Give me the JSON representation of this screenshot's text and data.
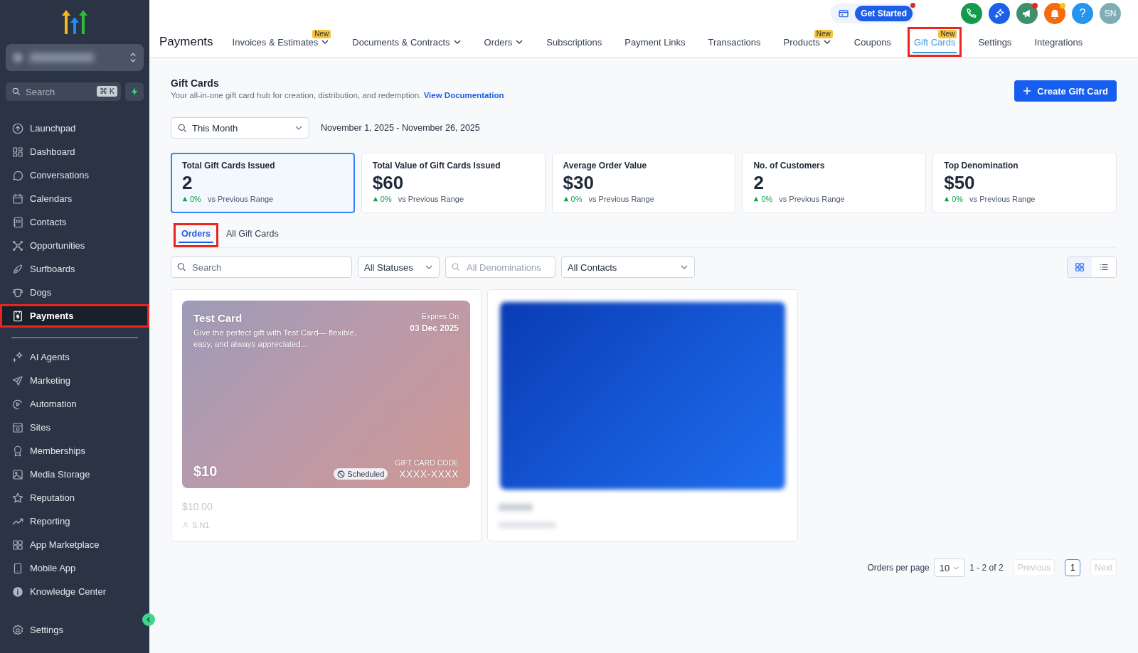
{
  "sidebar": {
    "search": {
      "placeholder": "Search",
      "shortcut": "⌘ K"
    },
    "items": [
      {
        "label": "Launchpad",
        "selected": false,
        "highlighted": false
      },
      {
        "label": "Dashboard",
        "selected": false,
        "highlighted": false
      },
      {
        "label": "Conversations",
        "selected": false,
        "highlighted": false
      },
      {
        "label": "Calendars",
        "selected": false,
        "highlighted": false
      },
      {
        "label": "Contacts",
        "selected": false,
        "highlighted": false
      },
      {
        "label": "Opportunities",
        "selected": false,
        "highlighted": false
      },
      {
        "label": "Surfboards",
        "selected": false,
        "highlighted": false
      },
      {
        "label": "Dogs",
        "selected": false,
        "highlighted": false
      },
      {
        "label": "Payments",
        "selected": true,
        "highlighted": true
      }
    ],
    "items_2": [
      {
        "label": "AI Agents",
        "selected": false
      },
      {
        "label": "Marketing",
        "selected": false
      },
      {
        "label": "Automation",
        "selected": false
      },
      {
        "label": "Sites",
        "selected": false
      },
      {
        "label": "Memberships",
        "selected": false
      },
      {
        "label": "Media Storage",
        "selected": false
      },
      {
        "label": "Reputation",
        "selected": false
      },
      {
        "label": "Reporting",
        "selected": false
      },
      {
        "label": "App Marketplace",
        "selected": false
      },
      {
        "label": "Mobile App",
        "selected": false
      },
      {
        "label": "Knowledge Center",
        "selected": false
      }
    ],
    "footer_item": {
      "label": "Settings"
    }
  },
  "header": {
    "get_started": {
      "label": "Get Started",
      "dot": true
    },
    "actions": [
      {
        "kind": "phone",
        "color": "#15994a"
      },
      {
        "kind": "sparkle",
        "color": "#1c5fe8"
      },
      {
        "kind": "megaphone",
        "color": "#3f8f6c",
        "dot": {
          "color": "#ef2323"
        }
      },
      {
        "kind": "bell",
        "color": "#f66a0f",
        "dot": {
          "color": "#f5c518"
        }
      },
      {
        "kind": "help",
        "color": "#2496f2",
        "label": "?"
      }
    ],
    "avatar": "SN"
  },
  "nav": {
    "title": "Payments",
    "tabs": [
      {
        "label": "Invoices & Estimates",
        "badge": "New",
        "dropdown": true,
        "selected": false,
        "highlighted": false
      },
      {
        "label": "Documents & Contracts",
        "dropdown": true,
        "selected": false,
        "highlighted": false
      },
      {
        "label": "Orders",
        "dropdown": true,
        "selected": false,
        "highlighted": false
      },
      {
        "label": "Subscriptions",
        "dropdown": false,
        "selected": false,
        "highlighted": false
      },
      {
        "label": "Payment Links",
        "dropdown": false,
        "selected": false,
        "highlighted": false
      },
      {
        "label": "Transactions",
        "dropdown": false,
        "selected": false,
        "highlighted": false
      },
      {
        "label": "Products",
        "badge": "New",
        "dropdown": true,
        "selected": false,
        "highlighted": false
      },
      {
        "label": "Coupons",
        "dropdown": false,
        "selected": false,
        "highlighted": false
      },
      {
        "label": "Gift Cards",
        "badge": "New",
        "dropdown": false,
        "selected": true,
        "highlighted": true
      },
      {
        "label": "Settings",
        "dropdown": false,
        "selected": false,
        "highlighted": false
      },
      {
        "label": "Integrations",
        "dropdown": false,
        "selected": false,
        "highlighted": false
      }
    ]
  },
  "page": {
    "title": "Gift Cards",
    "description": "Your all-in-one gift card hub for creation, distribution, and redemption.",
    "link": "View Documentation",
    "create_button": "Create Gift Card"
  },
  "date_filter": {
    "value": "This Month",
    "range": "November 1, 2025 - November 26, 2025"
  },
  "stats": [
    {
      "title": "Total Gift Cards Issued",
      "value": "2",
      "change": "0%",
      "compare": "vs Previous Range",
      "selected": true
    },
    {
      "title": "Total Value of Gift Cards Issued",
      "value": "$60",
      "change": "0%",
      "compare": "vs Previous Range",
      "selected": false
    },
    {
      "title": "Average Order Value",
      "value": "$30",
      "change": "0%",
      "compare": "vs Previous Range",
      "selected": false
    },
    {
      "title": "No. of Customers",
      "value": "2",
      "change": "0%",
      "compare": "vs Previous Range",
      "selected": false
    },
    {
      "title": "Top Denomination",
      "value": "$50",
      "change": "0%",
      "compare": "vs Previous Range",
      "selected": false
    }
  ],
  "subtabs": [
    {
      "label": "Orders",
      "selected": true,
      "highlighted": true
    },
    {
      "label": "All Gift Cards",
      "selected": false,
      "highlighted": false
    }
  ],
  "filters": {
    "search_placeholder": "Search",
    "status": "All Statuses",
    "denomination_placeholder": "All Denominations",
    "contact": "All Contacts"
  },
  "view_toggle": [
    {
      "kind": "grid",
      "selected": true
    },
    {
      "kind": "list",
      "selected": false
    }
  ],
  "gift_cards": [
    {
      "kind": "visible",
      "name": "Test Card",
      "description": "Give the perfect gift with Test Card— flexible, easy, and always appreciated...",
      "expires_label": "Expires On",
      "expires": "03 Dec 2025",
      "amount": "$10",
      "code_label": "GIFT CARD CODE",
      "code": "XXXX-XXXX",
      "status": "Scheduled",
      "price": "$10.00",
      "customer": "S.N1"
    },
    {
      "kind": "blurred"
    }
  ],
  "pagination": {
    "label": "Orders per page",
    "per_page": "10",
    "range": "1 - 2 of 2",
    "previous": {
      "label": "Previous",
      "disabled": true
    },
    "pages": [
      {
        "label": "1",
        "selected": true
      }
    ],
    "next": {
      "label": "Next",
      "disabled": true
    }
  }
}
